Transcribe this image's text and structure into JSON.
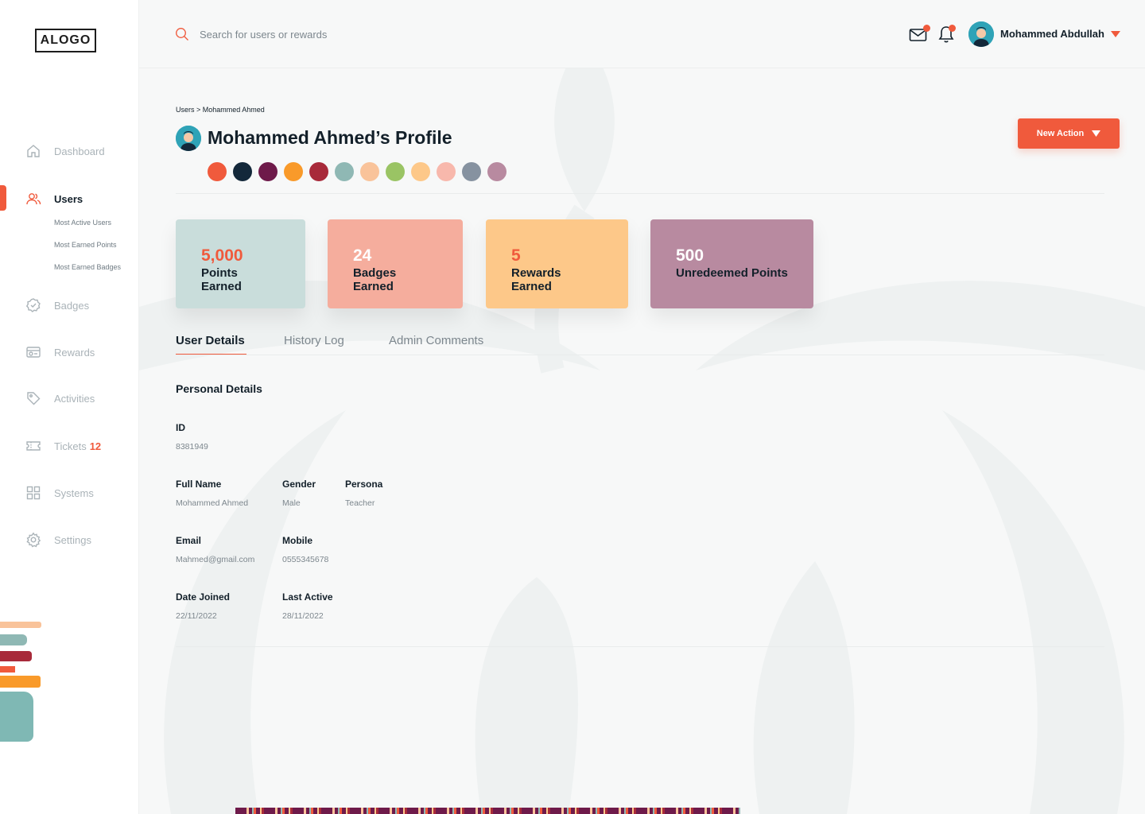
{
  "logo": "ALOGO",
  "sidebar": {
    "items": [
      {
        "label": "Dashboard",
        "icon": "home-icon"
      },
      {
        "label": "Users",
        "icon": "users-icon",
        "active": true,
        "subitems": [
          "Most Active Users",
          "Most Earned Points",
          "Most Earned Badges"
        ]
      },
      {
        "label": "Badges",
        "icon": "badge-icon"
      },
      {
        "label": "Rewards",
        "icon": "rewards-icon"
      },
      {
        "label": "Activities",
        "icon": "tag-icon"
      },
      {
        "label": "Tickets",
        "icon": "ticket-icon",
        "count": "12"
      },
      {
        "label": "Systems",
        "icon": "grid-icon"
      },
      {
        "label": "Settings",
        "icon": "gear-icon"
      }
    ]
  },
  "search": {
    "placeholder": "Search for users or rewards"
  },
  "header": {
    "user_name": "Mohammed Abdullah"
  },
  "breadcrumb": "Users > Mohammed Ahmed",
  "profile": {
    "title": "Mohammed Ahmed’s Profile",
    "colors": [
      "#f05a3c",
      "#13283a",
      "#6e1a4a",
      "#f99a2a",
      "#a82a3a",
      "#8fb8b4",
      "#f9c39a",
      "#9ac464",
      "#fdc889",
      "#f8b8ac",
      "#8692a0",
      "#b88aa0"
    ]
  },
  "actions": {
    "new_action": "New Action"
  },
  "stats": [
    {
      "value": "5,000",
      "label": "Points Earned",
      "bg": "#c9dddb",
      "value_color": "#f05a3c"
    },
    {
      "value": "24",
      "label": "Badges Earned",
      "bg": "#f5ad9d",
      "value_color": "#ffffff"
    },
    {
      "value": "5",
      "label": "Rewards Earned",
      "bg": "#fdc889",
      "value_color": "#f05a3c"
    },
    {
      "value": "500",
      "label": "Unredeemed Points",
      "bg": "#b88aa0",
      "value_color": "#ffffff"
    }
  ],
  "tabs": [
    "User Details",
    "History Log",
    "Admin Comments"
  ],
  "details": {
    "section_title": "Personal Details",
    "id_label": "ID",
    "id_value": "8381949",
    "full_name_label": "Full Name",
    "full_name_value": "Mohammed Ahmed",
    "gender_label": "Gender",
    "gender_value": "Male",
    "persona_label": "Persona",
    "persona_value": "Teacher",
    "email_label": "Email",
    "email_value": "Mahmed@gmail.com",
    "mobile_label": "Mobile",
    "mobile_value": "0555345678",
    "date_joined_label": "Date Joined",
    "date_joined_value": "22/11/2022",
    "last_active_label": "Last Active",
    "last_active_value": "28/11/2022"
  },
  "theme": {
    "accent": "#f05a3c",
    "text": "#13202a",
    "muted": "#7d878e"
  }
}
